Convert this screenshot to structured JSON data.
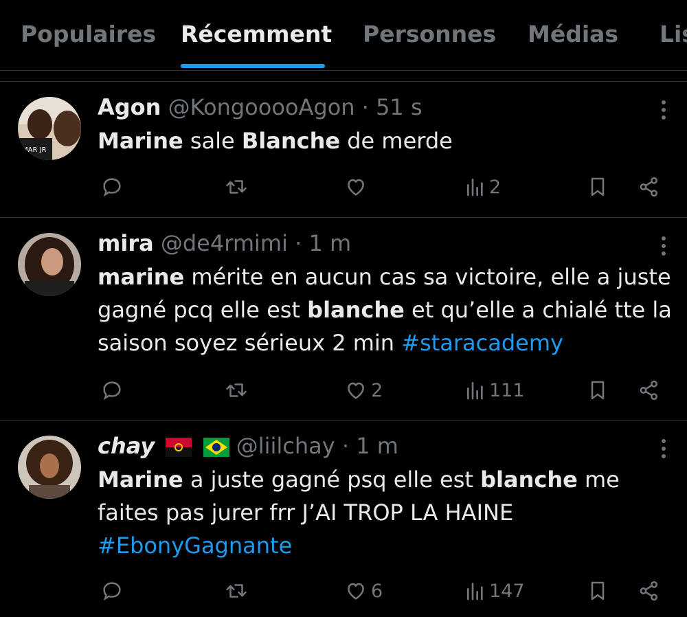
{
  "tabs": [
    {
      "label": "Populaires"
    },
    {
      "label": "Récemment"
    },
    {
      "label": "Personnes"
    },
    {
      "label": "Médias"
    },
    {
      "label": "Lis"
    }
  ],
  "colors": {
    "background": "#000000",
    "accent": "#1d9bf0",
    "muted": "#71767b",
    "text": "#e7e9ea"
  },
  "tweets": [
    {
      "name": "Agon",
      "handle": "@KongooooAgon",
      "time": "51 s",
      "text": {
        "w1": "Marine",
        "t1": " sale ",
        "w2": "Blanche",
        "t2": " de merde"
      },
      "views": "2",
      "likes": ""
    },
    {
      "name": "mira",
      "handle": "@de4rmimi",
      "time": "1 m",
      "text": {
        "w1": "marine",
        "t1": " mérite en aucun cas sa victoire, elle a juste gagné pcq elle est ",
        "w2": "blanche",
        "t2": " et qu’elle a chialé tte la saison soyez sérieux 2 min ",
        "tag": "#staracademy"
      },
      "likes": "2",
      "views": "111"
    },
    {
      "name": "chay",
      "handle": "@liilchay",
      "time": "1 m",
      "flags": [
        "angola-flag",
        "brazil-flag"
      ],
      "text": {
        "w1": "Marine",
        "t1": " a juste gagné psq elle est ",
        "w2": "blanche",
        "t2": " me faites pas jurer frr J’AI TROP LA HAINE ",
        "tag": "#EbonyGagnante"
      },
      "likes": "6",
      "views": "147"
    }
  ],
  "icons": [
    "reply-icon",
    "retweet-icon",
    "heart-icon",
    "views-icon",
    "bookmark-icon",
    "share-icon",
    "more-icon"
  ]
}
